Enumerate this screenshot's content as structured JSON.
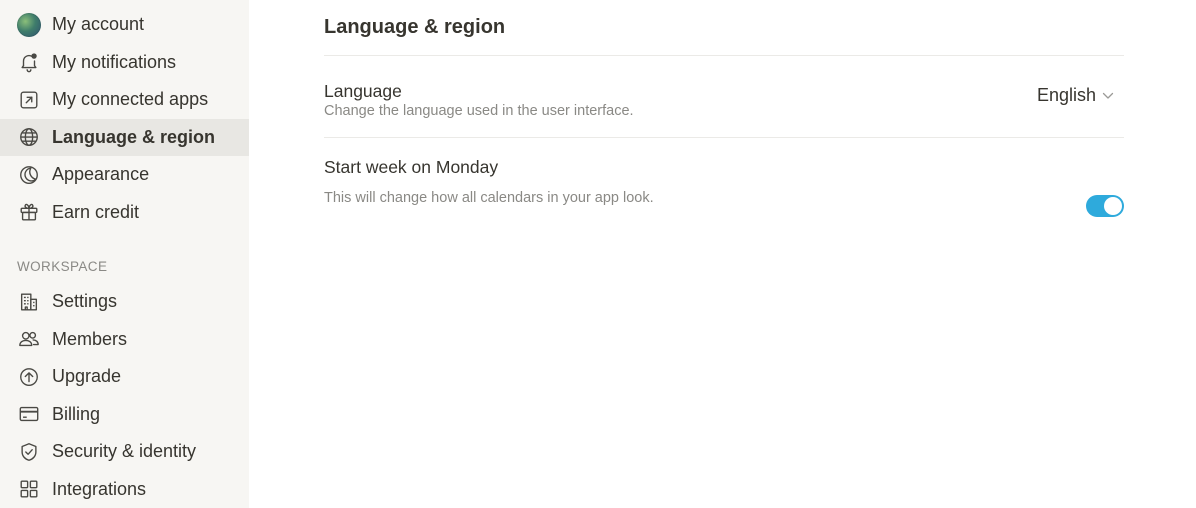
{
  "sidebar": {
    "items": [
      {
        "label": "My account",
        "icon": "avatar"
      },
      {
        "label": "My notifications",
        "icon": "bell-icon"
      },
      {
        "label": "My connected apps",
        "icon": "external-link-icon"
      },
      {
        "label": "Language & region",
        "icon": "globe-icon",
        "active": true
      },
      {
        "label": "Appearance",
        "icon": "moon-icon"
      },
      {
        "label": "Earn credit",
        "icon": "gift-icon"
      }
    ],
    "workspace_label": "WORKSPACE",
    "workspace_items": [
      {
        "label": "Settings",
        "icon": "building-icon"
      },
      {
        "label": "Members",
        "icon": "people-icon"
      },
      {
        "label": "Upgrade",
        "icon": "arrow-up-circle-icon"
      },
      {
        "label": "Billing",
        "icon": "credit-card-icon"
      },
      {
        "label": "Security & identity",
        "icon": "shield-check-icon"
      },
      {
        "label": "Integrations",
        "icon": "grid-icon"
      }
    ]
  },
  "main": {
    "title": "Language & region",
    "language": {
      "title": "Language",
      "description": "Change the language used in the user interface.",
      "value": "English"
    },
    "week": {
      "title": "Start week on Monday",
      "description": "This will change how all calendars in your app look.",
      "enabled": true
    }
  },
  "colors": {
    "sidebar_bg": "#f7f6f3",
    "active_bg": "#e8e7e3",
    "toggle_on": "#2eaadc",
    "text": "#37352f",
    "muted": "#8a8985"
  }
}
